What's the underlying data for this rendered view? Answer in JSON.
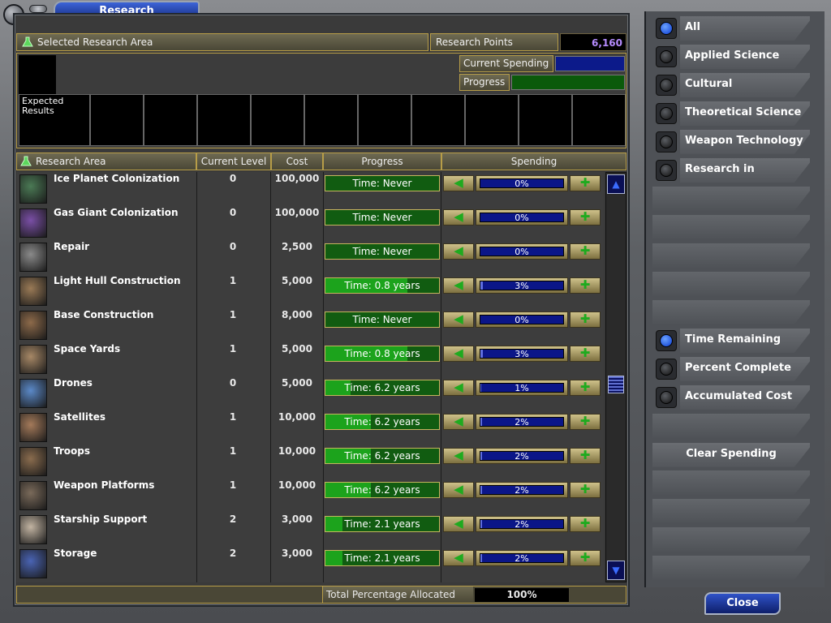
{
  "window": {
    "title": "Research"
  },
  "header": {
    "selected_area_label": "Selected Research Area",
    "rp_label": "Research Points Available",
    "rp_value": "6,160"
  },
  "info": {
    "current_spending_label": "Current Spending",
    "progress_label": "Progress",
    "expected_results_label": "Expected Results"
  },
  "columns": {
    "area": "Research Area",
    "level": "Current Level",
    "cost": "Cost",
    "progress": "Progress",
    "spending": "Spending"
  },
  "rows": [
    {
      "name": "Ice Planet Colonization",
      "level": "0",
      "cost": "100,000",
      "progress": "Time: Never",
      "progress_fraction": 0.0,
      "spending": "0%",
      "spending_fraction": 0.0
    },
    {
      "name": "Gas Giant Colonization",
      "level": "0",
      "cost": "100,000",
      "progress": "Time: Never",
      "progress_fraction": 0.0,
      "spending": "0%",
      "spending_fraction": 0.0
    },
    {
      "name": "Repair",
      "level": "0",
      "cost": "2,500",
      "progress": "Time: Never",
      "progress_fraction": 0.0,
      "spending": "0%",
      "spending_fraction": 0.0
    },
    {
      "name": "Light Hull Construction",
      "level": "1",
      "cost": "5,000",
      "progress": "Time: 0.8 years",
      "progress_fraction": 0.72,
      "spending": "3%",
      "spending_fraction": 0.03
    },
    {
      "name": "Base Construction",
      "level": "1",
      "cost": "8,000",
      "progress": "Time: Never",
      "progress_fraction": 0.0,
      "spending": "0%",
      "spending_fraction": 0.0
    },
    {
      "name": "Space Yards",
      "level": "1",
      "cost": "5,000",
      "progress": "Time: 0.8 years",
      "progress_fraction": 0.72,
      "spending": "3%",
      "spending_fraction": 0.03
    },
    {
      "name": "Drones",
      "level": "0",
      "cost": "5,000",
      "progress": "Time: 6.2 years",
      "progress_fraction": 0.22,
      "spending": "1%",
      "spending_fraction": 0.01
    },
    {
      "name": "Satellites",
      "level": "1",
      "cost": "10,000",
      "progress": "Time: 6.2 years",
      "progress_fraction": 0.4,
      "spending": "2%",
      "spending_fraction": 0.02
    },
    {
      "name": "Troops",
      "level": "1",
      "cost": "10,000",
      "progress": "Time: 6.2 years",
      "progress_fraction": 0.4,
      "spending": "2%",
      "spending_fraction": 0.02
    },
    {
      "name": "Weapon Platforms",
      "level": "1",
      "cost": "10,000",
      "progress": "Time: 6.2 years",
      "progress_fraction": 0.4,
      "spending": "2%",
      "spending_fraction": 0.02
    },
    {
      "name": "Starship Support",
      "level": "2",
      "cost": "3,000",
      "progress": "Time: 2.1 years",
      "progress_fraction": 0.15,
      "spending": "2%",
      "spending_fraction": 0.02
    },
    {
      "name": "Storage",
      "level": "2",
      "cost": "3,000",
      "progress": "Time: 2.1 years",
      "progress_fraction": 0.15,
      "spending": "2%",
      "spending_fraction": 0.02
    }
  ],
  "footer": {
    "total_label": "Total Percentage Allocated",
    "total_value": "100%"
  },
  "filters": [
    {
      "label": "All",
      "selected": true
    },
    {
      "label": "Applied Science",
      "selected": false
    },
    {
      "label": "Cultural Advancement",
      "selected": false
    },
    {
      "label": "Theoretical Science",
      "selected": false
    },
    {
      "label": "Weapon Technology",
      "selected": false
    },
    {
      "label": "Research in Progress",
      "selected": false
    }
  ],
  "display_modes": [
    {
      "label": "Time Remaining",
      "selected": true
    },
    {
      "label": "Percent Complete",
      "selected": false
    },
    {
      "label": "Accumulated Cost",
      "selected": false
    }
  ],
  "buttons": {
    "clear_spending": "Clear Spending",
    "close": "Close"
  },
  "icons": {
    "row_icons": [
      "ice-planet-icon",
      "gas-giant-icon",
      "wrench-icon",
      "light-hull-icon",
      "base-construction-icon",
      "space-yards-icon",
      "drone-icon",
      "satellite-icon",
      "troops-icon",
      "weapon-platform-icon",
      "astronaut-icon",
      "storage-icon"
    ],
    "row_icon_colors": [
      "#4b7a55",
      "#7a4fa6",
      "#8a8a8a",
      "#9a7a56",
      "#8d6a4a",
      "#a78866",
      "#5b89c8",
      "#a47a5a",
      "#8a6c4e",
      "#7a6a5a",
      "#c2b4a2",
      "#4a64b4"
    ]
  }
}
